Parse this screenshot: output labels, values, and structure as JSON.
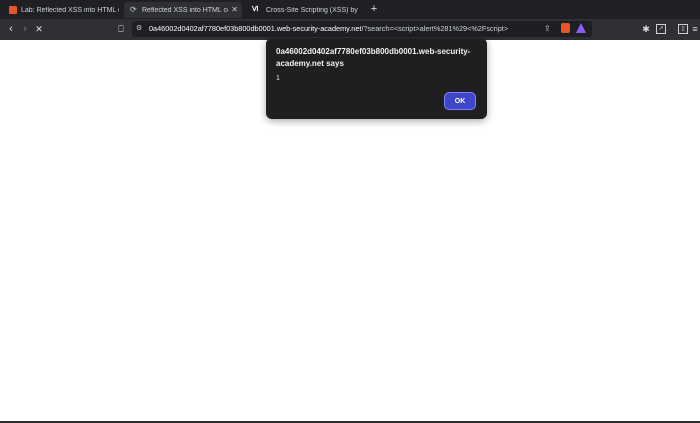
{
  "tabs": [
    {
      "label": "Lab: Reflected XSS into HTML conte",
      "icon": "portswigger-icon",
      "color": "#e8532a"
    },
    {
      "label": "Reflected XSS into HTML conte",
      "icon": "loading-icon",
      "color": "#c9ccd1",
      "active": true
    },
    {
      "label": "Cross-Site Scripting (XSS) by PortSw",
      "icon": "portswigger-brand-icon",
      "color": "#ffffff"
    }
  ],
  "new_tab": "+",
  "url": {
    "domain": "0a46002d0402af7780ef03b800db0001.web-security-academy.net",
    "path": "/?search=<script>alert%281%29<%2Fscript>"
  },
  "alert": {
    "title": "0a46002d0402af7780ef03b800db0001.web-security-academy.net says",
    "message": "1",
    "ok_label": "OK"
  }
}
